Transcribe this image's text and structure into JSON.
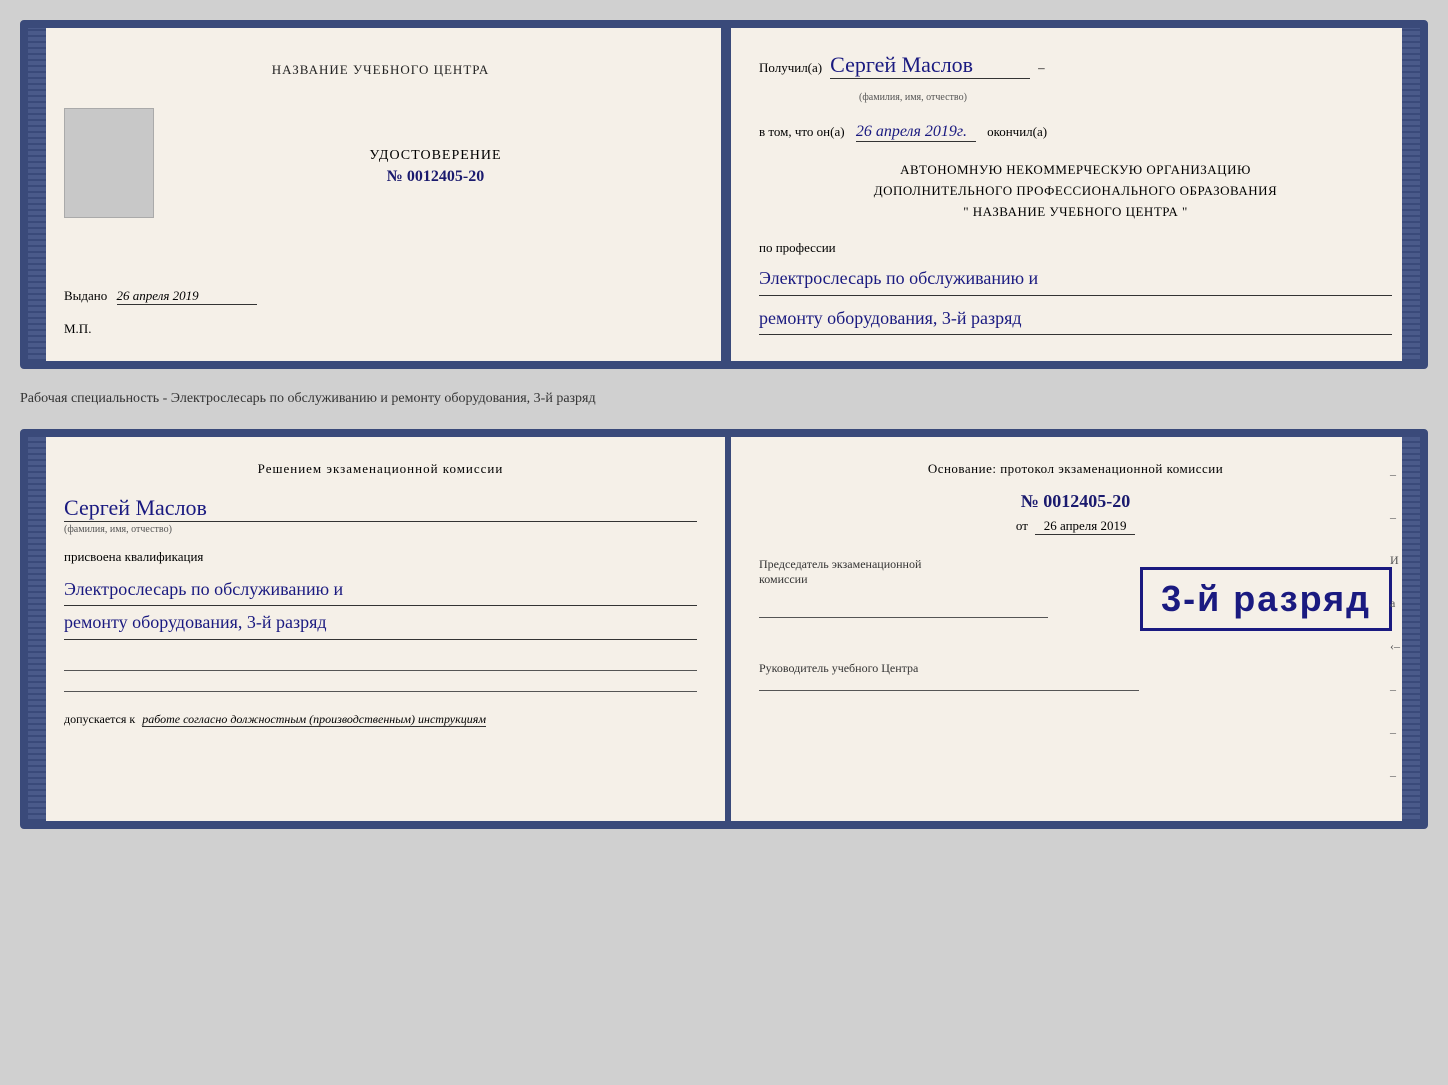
{
  "cert1": {
    "left": {
      "center_title": "НАЗВАНИЕ УЧЕБНОГО ЦЕНТРА",
      "udostoverenie_title": "УДОСТОВЕРЕНИЕ",
      "cert_number": "№ 0012405-20",
      "issued_label": "Выдано",
      "issued_date": "26 апреля 2019",
      "mp": "М.П."
    },
    "right": {
      "received_label": "Получил(а)",
      "name": "Сергей Маслов",
      "name_sublabel": "(фамилия, имя, отчество)",
      "dash": "–",
      "v_tom_label": "в том, что он(а)",
      "date_handwritten": "26 апреля 2019г.",
      "okonchill": "окончил(а)",
      "org_line1": "АВТОНОМНУЮ НЕКОММЕРЧЕСКУЮ ОРГАНИЗАЦИЮ",
      "org_line2": "ДОПОЛНИТЕЛЬНОГО ПРОФЕССИОНАЛЬНОГО ОБРАЗОВАНИЯ",
      "org_line3": "\"   НАЗВАНИЕ УЧЕБНОГО ЦЕНТРА   \"",
      "po_professii": "по профессии",
      "profession_line1": "Электрослесарь по обслуживанию и",
      "profession_line2": "ремонту оборудования, 3-й разряд"
    }
  },
  "between_label": "Рабочая специальность - Электрослесарь по обслуживанию и ремонту оборудования, 3-й разряд",
  "cert2": {
    "left": {
      "reshenie_title": "Решением  экзаменационной  комиссии",
      "name": "Сергей Маслов",
      "name_sublabel": "(фамилия, имя, отчество)",
      "prisvoena": "присвоена квалификация",
      "qual_line1": "Электрослесарь по обслуживанию и",
      "qual_line2": "ремонту оборудования, 3-й разряд",
      "dopuskaetsya": "допускается к",
      "dopusk_italic": "работе согласно должностным (производственным) инструкциям"
    },
    "right": {
      "osnovanie": "Основание: протокол экзаменационной  комиссии",
      "number": "№  0012405-20",
      "ot_label": "от",
      "ot_date": "26 апреля 2019",
      "predsedatel_label": "Председатель экзаменационной комиссии",
      "stamp_text": "3-й разряд",
      "rukovoditel_label": "Руководитель учебного Центра"
    }
  }
}
